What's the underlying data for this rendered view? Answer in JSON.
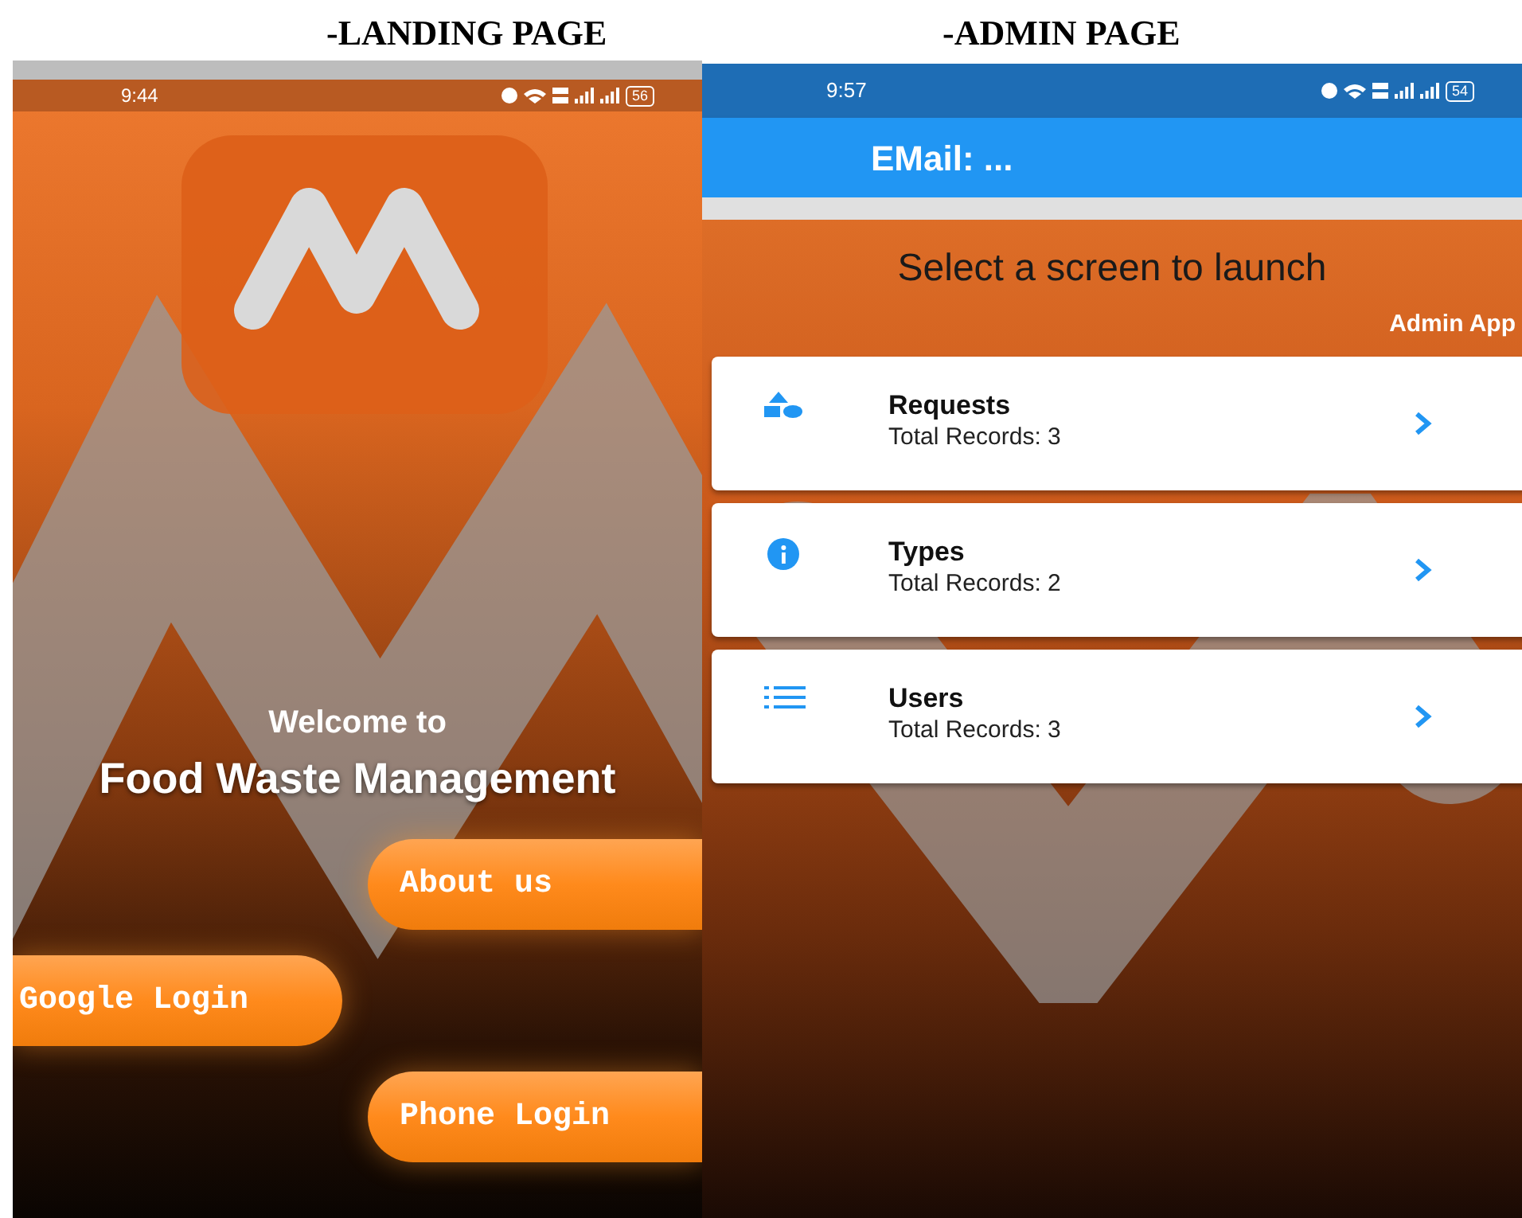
{
  "captions": [
    "-LANDING PAGE",
    "-ADMIN PAGE"
  ],
  "landing": {
    "status_bar": {
      "time": "9:44",
      "battery": "56"
    },
    "welcome": "Welcome to",
    "app_name": "Food Waste Management",
    "buttons": [
      {
        "label": "About us",
        "kind": "trailing"
      },
      {
        "label": "Google Login",
        "kind": "leading"
      },
      {
        "label": "Phone Login",
        "kind": "trailing"
      }
    ]
  },
  "admin": {
    "status_bar": {
      "time": "9:57",
      "battery": "54"
    },
    "app_bar_title": "EMail: ...",
    "heading": "Select a screen to launch",
    "subtitle": "Admin App",
    "items": [
      {
        "kind": "shapes",
        "title": "Requests",
        "subtitle": "Total Records: 3"
      },
      {
        "kind": "info",
        "title": "Types",
        "subtitle": "Total Records: 2"
      },
      {
        "kind": "list",
        "title": "Users",
        "subtitle": "Total Records: 3"
      }
    ]
  }
}
